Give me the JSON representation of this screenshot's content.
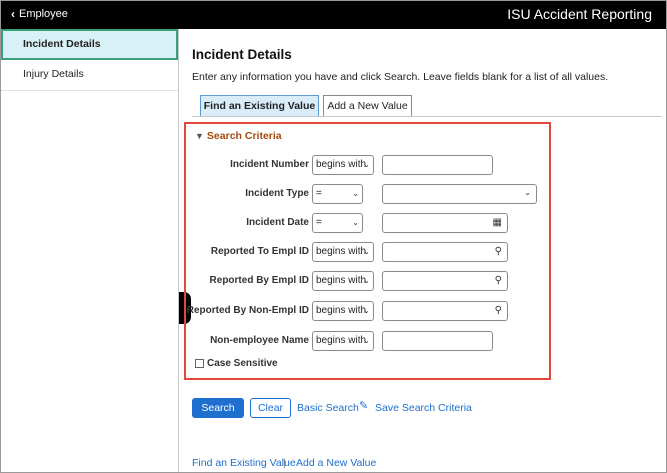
{
  "topbar": {
    "back_label": "Employee",
    "app_title": "ISU Accident Reporting"
  },
  "sidebar": {
    "items": [
      {
        "label": "Incident Details"
      },
      {
        "label": "Injury Details"
      }
    ]
  },
  "main": {
    "title": "Incident Details",
    "instructions": "Enter any information you have and click Search. Leave fields blank for a list of all values.",
    "tabs": [
      {
        "label": "Find an Existing Value"
      },
      {
        "label": "Add a New Value"
      }
    ]
  },
  "search": {
    "heading": "Search Criteria",
    "fields": [
      {
        "label": "Incident Number",
        "operator": "begins with",
        "value": ""
      },
      {
        "label": "Incident Type",
        "operator": "=",
        "value": ""
      },
      {
        "label": "Incident Date",
        "operator": "=",
        "value": ""
      },
      {
        "label": "Reported To Empl ID",
        "operator": "begins with",
        "value": ""
      },
      {
        "label": "Reported By Empl ID",
        "operator": "begins with",
        "value": ""
      },
      {
        "label": "Reported By Non-Empl ID",
        "operator": "begins with",
        "value": ""
      },
      {
        "label": "Non-employee Name",
        "operator": "begins with",
        "value": ""
      }
    ],
    "case_sensitive_label": "Case Sensitive"
  },
  "actions": {
    "search_label": "Search",
    "clear_label": "Clear",
    "basic_search_label": "Basic Search",
    "save_criteria_label": "Save Search Criteria"
  },
  "footer": {
    "find_link": "Find an Existing Value",
    "separator": "|",
    "add_link": "Add a New Value"
  },
  "colors": {
    "accent": "#1f6fce",
    "highlight_border": "#e1473f",
    "section_heading": "#a5480f",
    "active_nav_bg": "#d8f1f6"
  }
}
